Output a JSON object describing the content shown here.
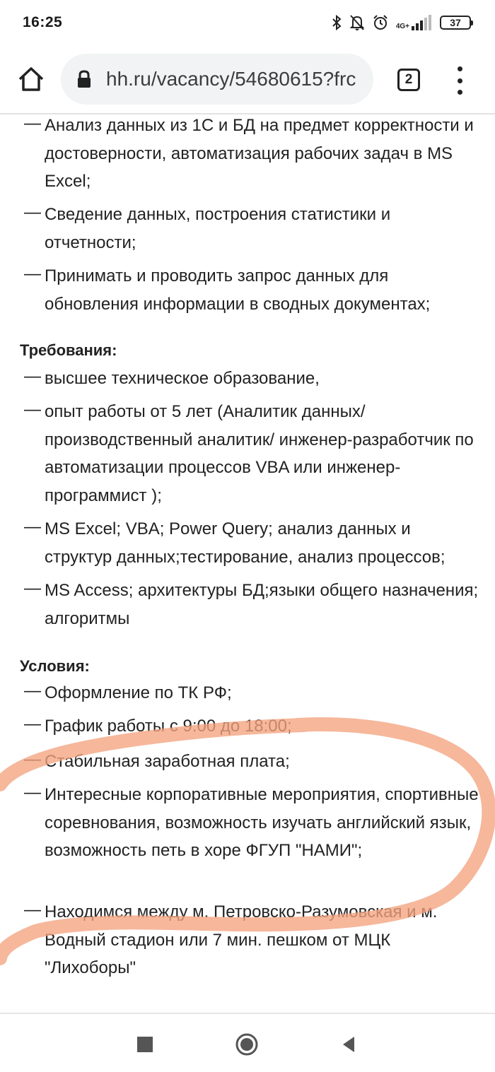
{
  "status": {
    "time": "16:25",
    "network": "4G+",
    "battery": "37"
  },
  "browser": {
    "url": "hh.ru/vacancy/54680615?frc",
    "tabs_count": "2"
  },
  "duties": [
    "Анализ данных из 1С и БД на предмет корректности и достоверности, автоматизация рабочих задач в MS Excel;",
    "Сведение данных, построения статистики и отчетности;",
    "Принимать и проводить запрос данных для обновления информации в сводных документах;"
  ],
  "requirements": {
    "heading": "Требования:",
    "items": [
      "высшее техническое образование,",
      "опыт работы от 5 лет (Аналитик данных/ производственный аналитик/ инженер-разработчик по автоматизации процессов VBA или инженер-программист );",
      "MS Excel; VBA; Power Query; анализ данных и структур данных;тестирование, анализ процессов;",
      "MS Access; архитектуры БД;языки общего назначения; алгоритмы"
    ]
  },
  "conditions": {
    "heading": "Условия:",
    "items": [
      "Оформление по ТК РФ;",
      "График работы с 9:00 до 18:00;",
      "Стабильная заработная плата;",
      "Интересные корпоративные мероприятия, спортивные соревнования, возможность изучать английский язык, возможность петь в хоре ФГУП \"НАМИ\";",
      "Находимся между м. Петровско-Разумовская и м. Водный стадион или 7 мин. пешком от МЦК \"Лихоборы\""
    ]
  },
  "colors": {
    "annotation_stroke": "#f4a37f",
    "text": "#222222",
    "url_bg": "#f1f3f4"
  }
}
